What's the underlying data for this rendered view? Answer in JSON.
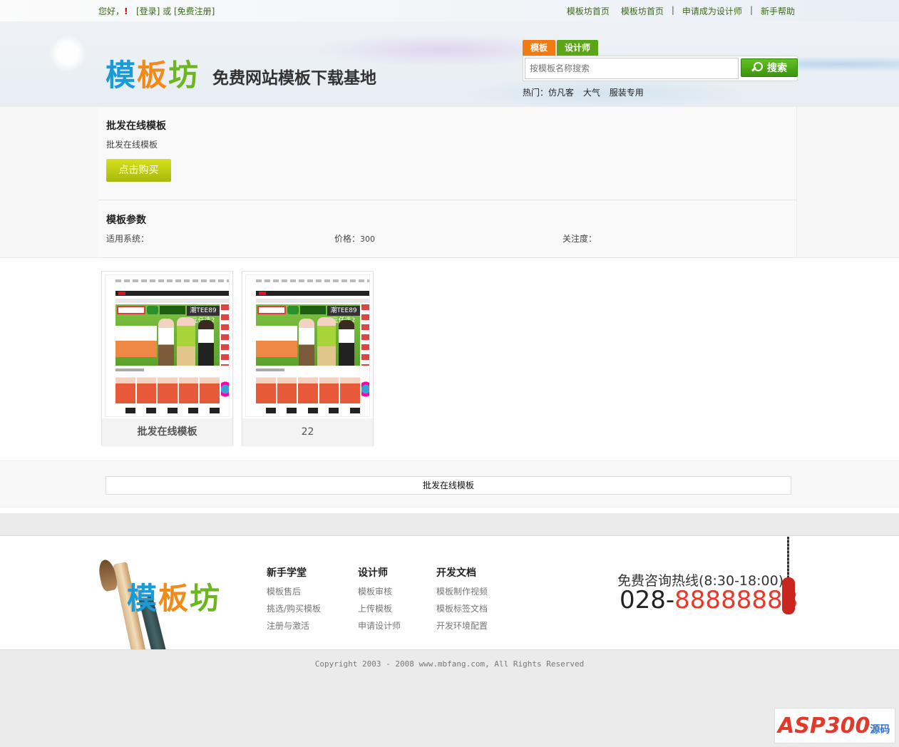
{
  "topbar": {
    "greeting": "您好，",
    "warn": "!",
    "login": "[登录]",
    "or": "或",
    "register": "[免费注册]",
    "nav": [
      "模板坊首页",
      "模板坊首页",
      "申请成为设计师",
      "新手帮助"
    ]
  },
  "header": {
    "logo": [
      "模",
      "板",
      "坊"
    ],
    "slogan": "免费网站模板下载基地",
    "search_tabs": [
      "模板",
      "设计师"
    ],
    "search_placeholder": "按模板名称搜索",
    "search_button": "搜索",
    "hot_label": "热门：",
    "hot_items": [
      "仿凡客",
      "大气",
      "服装专用"
    ]
  },
  "detail": {
    "title": "批发在线模板",
    "subtitle": "批发在线模板",
    "buy_button": "点击购买",
    "params_title": "模板参数",
    "params": {
      "system_label": "适用系统：",
      "system_value": "",
      "price_label": "价格：",
      "price_value": "300",
      "attention_label": "关注度：",
      "attention_value": ""
    }
  },
  "thumbs": [
    {
      "caption": "批发在线模板",
      "banner_text": "潮TEE89元任选2"
    },
    {
      "caption": "22",
      "banner_text": "潮TEE89元任选2"
    }
  ],
  "strip_title": "批发在线模板",
  "footer": {
    "logo": [
      "模",
      "板",
      "坊"
    ],
    "columns": [
      {
        "title": "新手学堂",
        "links": [
          "模板售后",
          "挑选/购买模板",
          "注册与激活"
        ]
      },
      {
        "title": "设计师",
        "links": [
          "模板审核",
          "上传模板",
          "申请设计师"
        ]
      },
      {
        "title": "开发文档",
        "links": [
          "模板制作视频",
          "模板标签文档",
          "开发环境配置"
        ]
      }
    ],
    "hotline": "免费咨询热线(8:30-18:00)",
    "phone_prefix": "028-",
    "phone_number": "88888888",
    "copyright": "Copyright 2003 - 2008 www.mbfang.com, All Rights Reserved"
  },
  "watermark": {
    "main": "ASP300",
    "sub": "源码"
  }
}
